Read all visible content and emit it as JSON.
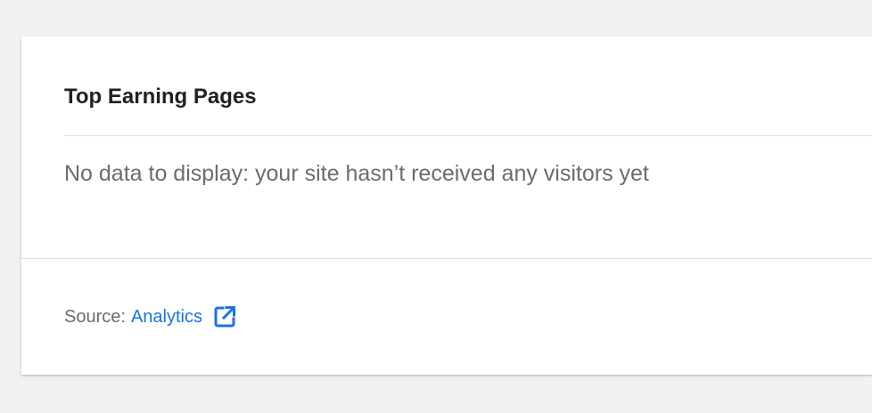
{
  "widget": {
    "title": "Top Earning Pages",
    "empty_message": "No data to display: your site hasn’t received any visitors yet",
    "footer": {
      "source_prefix": "Source:",
      "source_link_label": "Analytics",
      "link_icon": "external-link-icon"
    }
  },
  "colors": {
    "page_background": "#f1f1f1",
    "card_background": "#ffffff",
    "title_text": "#202124",
    "muted_text": "#6c6c6c",
    "link": "#1a73e8",
    "divider": "#e0e0e0"
  }
}
